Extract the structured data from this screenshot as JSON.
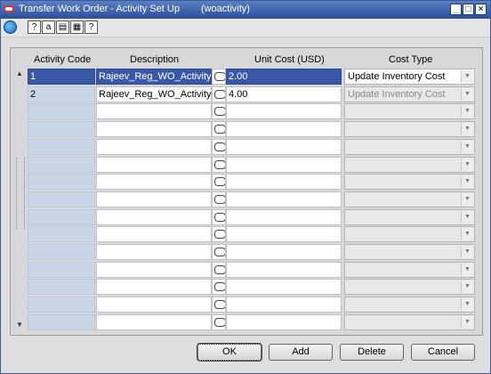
{
  "window": {
    "title": "Transfer Work Order - Activity Set Up",
    "form_id": "(woactivity)"
  },
  "toolbar": {
    "icons": [
      "globe-icon",
      "help-icon",
      "spellcheck-icon",
      "clipboard-icon",
      "print-icon",
      "question-icon"
    ]
  },
  "table": {
    "headers": {
      "code": "Activity Code",
      "desc": "Description",
      "cost": "Unit Cost (USD)",
      "type": "Cost Type"
    },
    "rows": [
      {
        "code": "1",
        "desc": "Rajeev_Reg_WO_Activity_IR",
        "cost": "2.00",
        "type": "Update Inventory Cost"
      },
      {
        "code": "2",
        "desc": "Rajeev_Reg_WO_Activity_All",
        "cost": "4.00",
        "type": "Update Inventory Cost"
      },
      {
        "code": "",
        "desc": "",
        "cost": "",
        "type": ""
      },
      {
        "code": "",
        "desc": "",
        "cost": "",
        "type": ""
      },
      {
        "code": "",
        "desc": "",
        "cost": "",
        "type": ""
      },
      {
        "code": "",
        "desc": "",
        "cost": "",
        "type": ""
      },
      {
        "code": "",
        "desc": "",
        "cost": "",
        "type": ""
      },
      {
        "code": "",
        "desc": "",
        "cost": "",
        "type": ""
      },
      {
        "code": "",
        "desc": "",
        "cost": "",
        "type": ""
      },
      {
        "code": "",
        "desc": "",
        "cost": "",
        "type": ""
      },
      {
        "code": "",
        "desc": "",
        "cost": "",
        "type": ""
      },
      {
        "code": "",
        "desc": "",
        "cost": "",
        "type": ""
      },
      {
        "code": "",
        "desc": "",
        "cost": "",
        "type": ""
      },
      {
        "code": "",
        "desc": "",
        "cost": "",
        "type": ""
      },
      {
        "code": "",
        "desc": "",
        "cost": "",
        "type": ""
      }
    ]
  },
  "buttons": {
    "ok": "OK",
    "add": "Add",
    "delete": "Delete",
    "cancel": "Cancel"
  }
}
